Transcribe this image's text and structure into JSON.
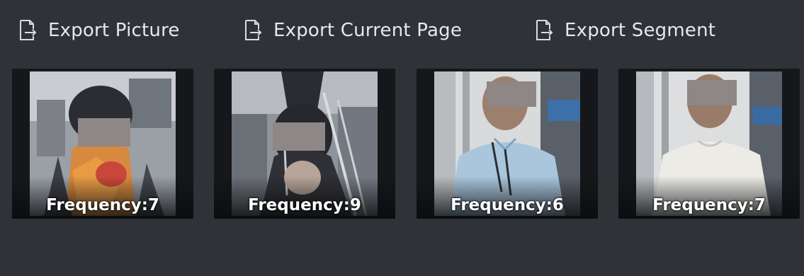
{
  "toolbar": {
    "export_picture": {
      "label": "Export Picture",
      "icon": "export-document-icon"
    },
    "export_current_page": {
      "label": "Export Current Page",
      "icon": "export-document-icon"
    },
    "export_segment": {
      "label": "Export Segment",
      "icon": "export-document-icon"
    }
  },
  "results": [
    {
      "frequency_label": "Frequency:7"
    },
    {
      "frequency_label": "Frequency:9"
    },
    {
      "frequency_label": "Frequency:6"
    },
    {
      "frequency_label": "Frequency:7"
    }
  ],
  "colors": {
    "background": "#2f3237",
    "thumbnail_frame": "#15171a",
    "text": "#e6e8eb",
    "face_mask": "#8f8785"
  }
}
